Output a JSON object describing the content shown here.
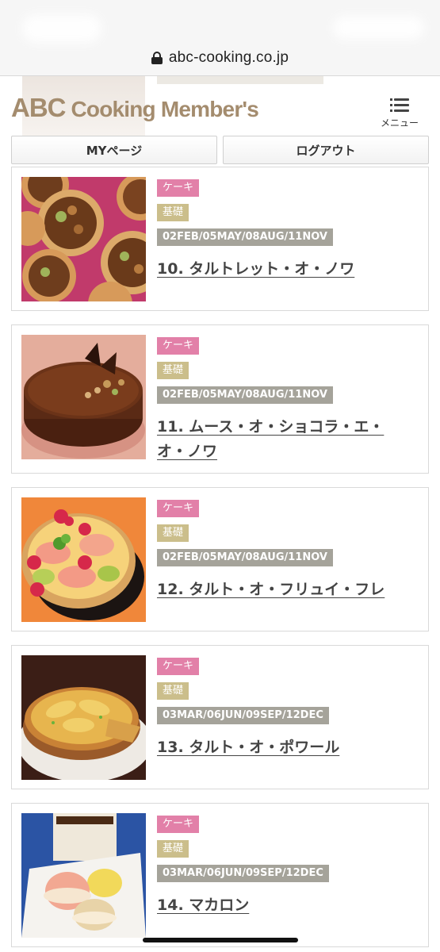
{
  "browser": {
    "url": "abc-cooking.co.jp"
  },
  "header": {
    "logo_abc": "ABC",
    "logo_rest": " Cooking Member's",
    "menu_label": "メニュー"
  },
  "nav": {
    "my_page": "MYページ",
    "logout": "ログアウト"
  },
  "recipes": [
    {
      "category": "ケーキ",
      "level": "基礎",
      "schedule": "02FEB/05MAY/08AUG/11NOV",
      "title": "10. タルトレット・オ・ノワ"
    },
    {
      "category": "ケーキ",
      "level": "基礎",
      "schedule": "02FEB/05MAY/08AUG/11NOV",
      "title": "11. ムース・オ・ショコラ・エ・オ・ノワ"
    },
    {
      "category": "ケーキ",
      "level": "基礎",
      "schedule": "02FEB/05MAY/08AUG/11NOV",
      "title": "12. タルト・オ・フリュイ・フレ"
    },
    {
      "category": "ケーキ",
      "level": "基礎",
      "schedule": "03MAR/06JUN/09SEP/12DEC",
      "title": "13. タルト・オ・ポワール"
    },
    {
      "category": "ケーキ",
      "level": "基礎",
      "schedule": "03MAR/06JUN/09SEP/12DEC",
      "title": "14. マカロン"
    }
  ],
  "colors": {
    "category_tag": "#e280a8",
    "level_tag": "#cbbe8b",
    "schedule_tag": "#a5a39a",
    "logo": "#a48c6e"
  }
}
